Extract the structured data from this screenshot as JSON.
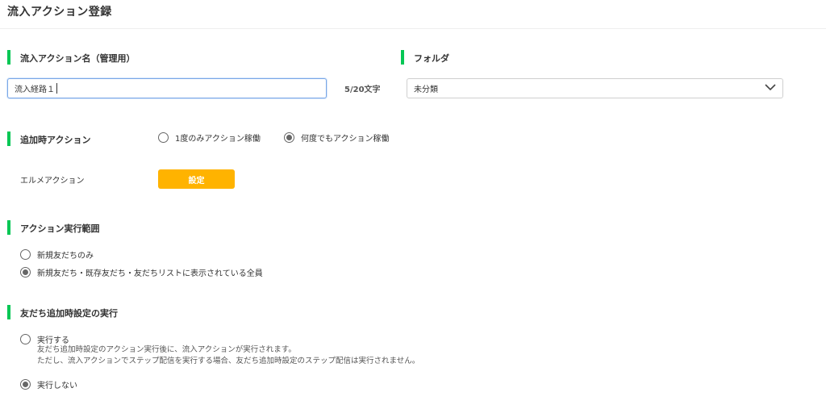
{
  "page": {
    "title": "流入アクション登録"
  },
  "action_name": {
    "label": "流入アクション名（管理用）",
    "value": "流入経路１",
    "counter": "5/20文字"
  },
  "folder": {
    "label": "フォルダ",
    "selected": "未分類"
  },
  "add_action": {
    "label": "追加時アクション",
    "options": [
      {
        "label": "1度のみアクション稼働",
        "checked": false
      },
      {
        "label": "何度でもアクション稼働",
        "checked": true
      }
    ],
    "elme_label": "エルメアクション",
    "set_button": "設定"
  },
  "scope": {
    "label": "アクション実行範囲",
    "options": [
      {
        "label": "新規友だちのみ",
        "checked": false
      },
      {
        "label": "新規友だち・既存友だち・友だちリストに表示されている全員",
        "checked": true
      }
    ]
  },
  "friend_setting": {
    "label": "友だち追加時設定の実行",
    "execute": {
      "label": "実行する",
      "checked": false,
      "desc1": "友だち追加時設定のアクション実行後に、流入アクションが実行されます。",
      "desc2": "ただし、流入アクションでステップ配信を実行する場合、友だち追加時設定のステップ配信は実行されません。"
    },
    "no_execute": {
      "label": "実行しない",
      "checked": true
    }
  },
  "colors": {
    "accent_green": "#06c755",
    "button_orange": "#ffb300",
    "input_focus": "#7aa7e6"
  }
}
